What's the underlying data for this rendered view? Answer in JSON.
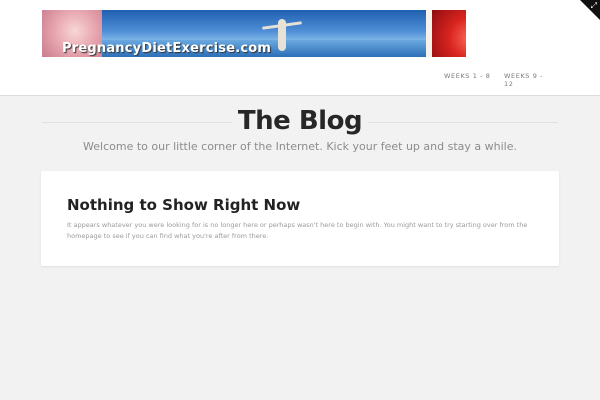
{
  "header": {
    "logo_text": "PregnancyDietExercise.com",
    "nav": [
      {
        "label": "WEEKS 1 - 8"
      },
      {
        "label": "WEEKS 9 - 12"
      }
    ],
    "corner_icon": "expand-icon"
  },
  "main": {
    "title": "The Blog",
    "subtitle": "Welcome to our little corner of the Internet. Kick your feet up and stay a while."
  },
  "card": {
    "title": "Nothing to Show Right Now",
    "body": "It appears whatever you were looking for is no longer here or perhaps wasn't here to begin with. You might want to try starting over from the homepage to see if you can find what you're after from there."
  },
  "colors": {
    "background": "#f2f2f2",
    "title": "#272727",
    "muted": "#8c8c8c"
  }
}
